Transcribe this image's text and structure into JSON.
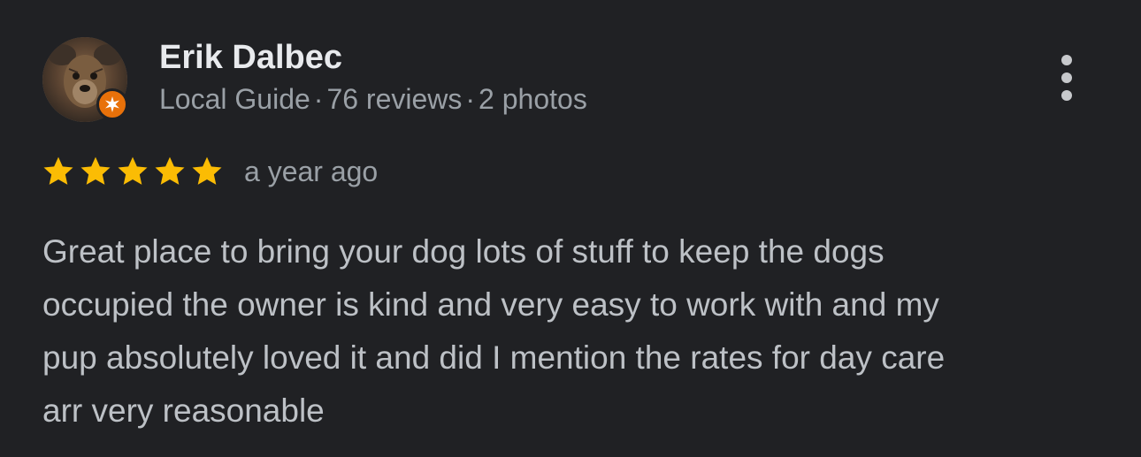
{
  "reviewer": {
    "name": "Erik Dalbec",
    "level": "Local Guide",
    "reviews": "76 reviews",
    "photos": "2 photos",
    "separator": "·"
  },
  "rating": {
    "stars": 5,
    "max_stars": 5,
    "star_color": "#fbbc04"
  },
  "time": "a year ago",
  "review_lines": [
    "Great place to bring your dog lots of stuff to keep the dogs",
    "occupied the owner is kind and very easy to work with and my",
    "pup absolutely loved it and did I mention the rates for day care",
    "arr very reasonable"
  ],
  "icons": {
    "avatar": "dog-avatar-image",
    "badge": "local-guide-star-icon",
    "menu": "more-vert-icon"
  },
  "colors": {
    "background": "#202124",
    "badge": "#e8710a"
  }
}
